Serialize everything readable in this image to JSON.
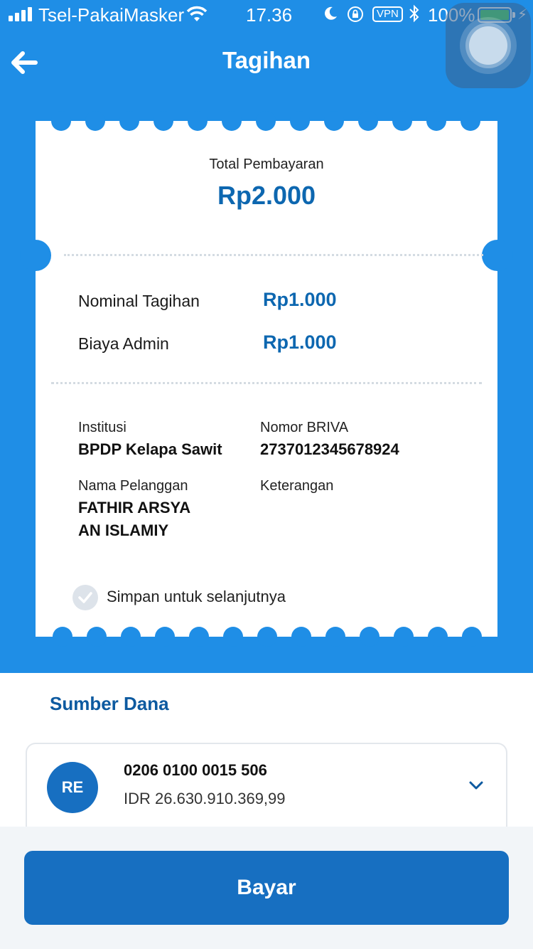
{
  "status_bar": {
    "carrier": "Tsel-PakaiMasker",
    "time": "17.36",
    "vpn": "VPN",
    "battery": "100%"
  },
  "header": {
    "title": "Tagihan",
    "back_icon": "arrow-left-icon"
  },
  "bill": {
    "total_label": "Total Pembayaran",
    "total_value": "Rp2.000",
    "rows": [
      {
        "label": "Nominal Tagihan",
        "value": "Rp1.000"
      },
      {
        "label": "Biaya Admin",
        "value": "Rp1.000"
      }
    ],
    "info": {
      "institution_label": "Institusi",
      "institution_value": "BPDP Kelapa Sawit",
      "briva_label": "Nomor BRIVA",
      "briva_value": "2737012345678924",
      "customer_label": "Nama Pelanggan",
      "customer_line1": "FATHIR ARSYA",
      "customer_line2": "AN ISLAMIY",
      "note_label": "Keterangan"
    },
    "save_label": "Simpan untuk selanjutnya"
  },
  "source": {
    "title": "Sumber Dana",
    "avatar": "RE",
    "account_number": "0206 0100 0015 506",
    "balance": "IDR 26.630.910.369,99"
  },
  "pay_button": "Bayar",
  "colors": {
    "primary": "#1f8ee6",
    "accent_text": "#0d67b0",
    "button": "#176fc1"
  }
}
